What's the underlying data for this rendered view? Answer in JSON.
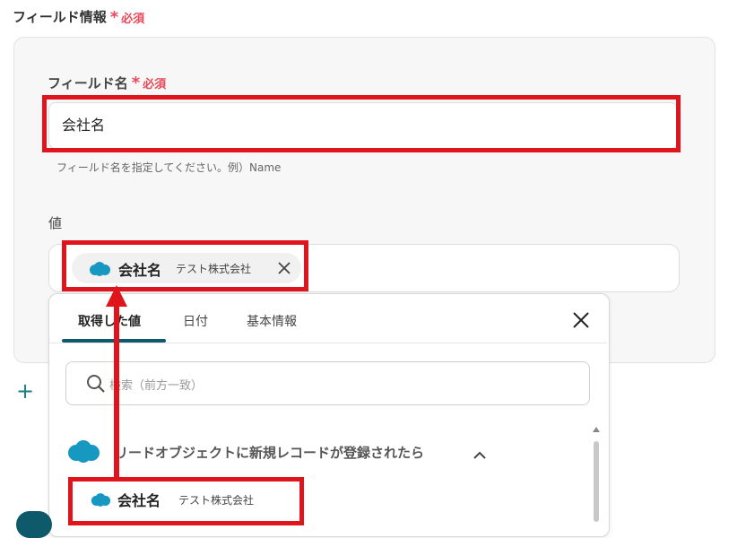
{
  "section": {
    "title": "フィールド情報",
    "required_star": "*",
    "required_text": "必須"
  },
  "field_name": {
    "label": "フィールド名",
    "required_star": "*",
    "required_text": "必須",
    "value": "会社名",
    "hint": "フィールド名を指定してください。例）Name"
  },
  "value_field": {
    "label": "値",
    "chip": {
      "icon": "salesforce-cloud-icon",
      "name": "会社名",
      "value": "テスト株式会社"
    }
  },
  "dropdown": {
    "tabs": [
      "取得した値",
      "日付",
      "基本情報"
    ],
    "active_tab": 0,
    "search_placeholder": "検索（前方一致）",
    "group": {
      "icon": "salesforce-cloud-icon",
      "title": "リードオブジェクトに新規レコードが登録されたら"
    },
    "items": [
      {
        "name": "会社名",
        "value": "テスト株式会社"
      }
    ]
  },
  "colors": {
    "accent": "#0e5a6a",
    "required": "#e64a5a",
    "highlight": "#e0141c",
    "salesforce": "#1798c1"
  }
}
